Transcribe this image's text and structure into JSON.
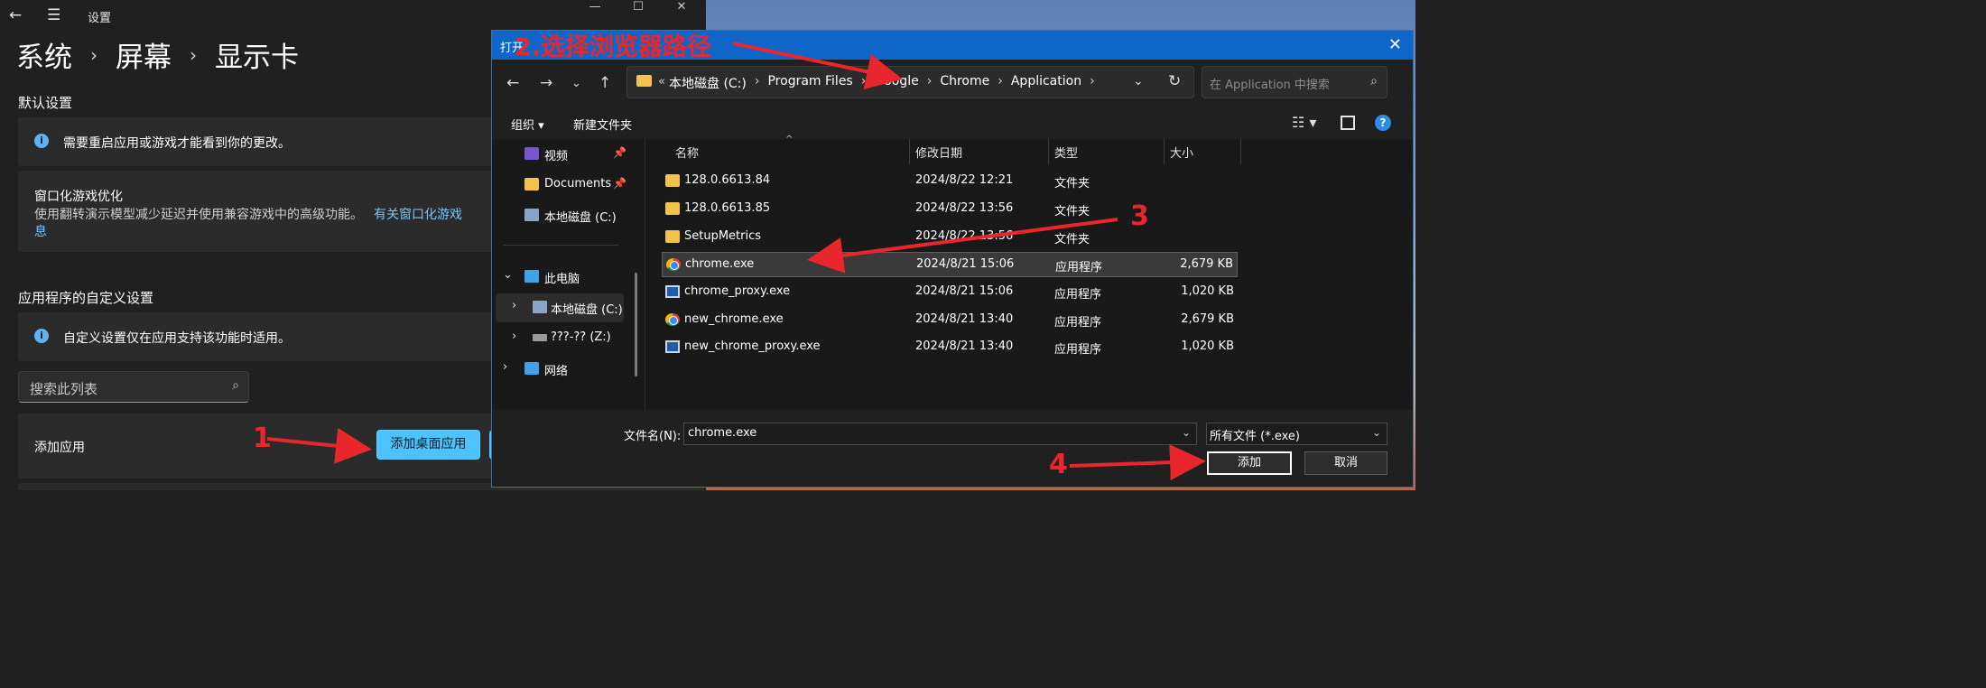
{
  "settings": {
    "app_title": "设置",
    "breadcrumb": [
      "系统",
      "屏幕",
      "显示卡"
    ],
    "default_section_title": "默认设置",
    "restart_notice": "需要重启应用或游戏才能看到你的更改。",
    "windowed_opt_title": "窗口化游戏优化",
    "windowed_opt_desc": "使用翻转演示模型减少延迟并使用兼容游戏中的高级功能。",
    "windowed_opt_link": "有关窗口化游戏",
    "windowed_opt_link2": "息",
    "app_custom_section_title": "应用程序的自定义设置",
    "custom_notice": "自定义设置仅在应用支持该功能时适用。",
    "search_placeholder": "搜索此列表",
    "add_app_label": "添加应用",
    "add_desktop_app_button": "添加桌面应用"
  },
  "dialog": {
    "title": "打开",
    "address": {
      "crumbs": [
        "本地磁盘 (C:)",
        "Program Files",
        "Google",
        "Chrome",
        "Application"
      ],
      "overflow": "«"
    },
    "search_placeholder": "在 Application 中搜索",
    "toolbar": {
      "organize": "组织 ▾",
      "new_folder": "新建文件夹"
    },
    "nav_pane": [
      {
        "label": "视频",
        "icon": "video-folder-icon",
        "pinned": true
      },
      {
        "label": "Documents",
        "icon": "documents-folder-icon",
        "pinned": true
      },
      {
        "label": "本地磁盘 (C:)",
        "icon": "drive-icon",
        "pinned": false
      },
      {
        "label": "此电脑",
        "icon": "this-pc-icon",
        "expanded": true
      },
      {
        "label": "本地磁盘 (C:)",
        "icon": "drive-icon",
        "selected": true
      },
      {
        "label": "???-?? (Z:)",
        "icon": "network-drive-icon"
      },
      {
        "label": "网络",
        "icon": "network-icon"
      }
    ],
    "columns": [
      "名称",
      "修改日期",
      "类型",
      "大小"
    ],
    "files": [
      {
        "name": "128.0.6613.84",
        "date": "2024/8/22 12:21",
        "type": "文件夹",
        "size": "",
        "icon": "folder-icon"
      },
      {
        "name": "128.0.6613.85",
        "date": "2024/8/22 13:56",
        "type": "文件夹",
        "size": "",
        "icon": "folder-icon"
      },
      {
        "name": "SetupMetrics",
        "date": "2024/8/22 13:56",
        "type": "文件夹",
        "size": "",
        "icon": "folder-icon"
      },
      {
        "name": "chrome.exe",
        "date": "2024/8/21 15:06",
        "type": "应用程序",
        "size": "2,679 KB",
        "icon": "chrome-icon",
        "selected": true
      },
      {
        "name": "chrome_proxy.exe",
        "date": "2024/8/21 15:06",
        "type": "应用程序",
        "size": "1,020 KB",
        "icon": "app-icon"
      },
      {
        "name": "new_chrome.exe",
        "date": "2024/8/21 13:40",
        "type": "应用程序",
        "size": "2,679 KB",
        "icon": "chrome-icon"
      },
      {
        "name": "new_chrome_proxy.exe",
        "date": "2024/8/21 13:40",
        "type": "应用程序",
        "size": "1,020 KB",
        "icon": "app-icon"
      }
    ],
    "filename_label": "文件名(N):",
    "filename_value": "chrome.exe",
    "filetype_value": "所有文件 (*.exe)",
    "open_button": "添加",
    "cancel_button": "取消"
  },
  "annotations": {
    "step1": "1",
    "step2": "2.选择浏览器路径",
    "step3": "3",
    "step4": "4",
    "color": "#e8262b"
  }
}
